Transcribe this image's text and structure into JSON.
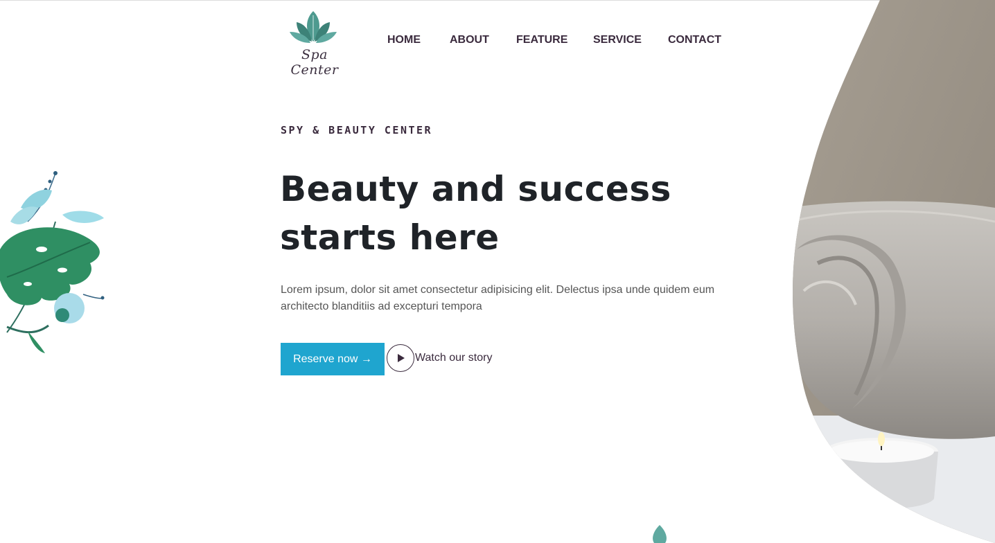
{
  "brand": {
    "logo_text": "Spa Center",
    "accent_color": "#1fa5cf",
    "text_color": "#3a2a3d"
  },
  "nav": {
    "items": [
      {
        "label": "HOME"
      },
      {
        "label": "ABOUT"
      },
      {
        "label": "FEATURE"
      },
      {
        "label": "SERVICE"
      },
      {
        "label": "CONTACT"
      }
    ]
  },
  "hero": {
    "eyebrow": "SPY & BEAUTY CENTER",
    "headline": "Beauty and success starts here",
    "description": "Lorem ipsum, dolor sit amet consectetur adipisicing elit. Delectus ipsa unde quidem eum architecto blanditiis ad excepturi tempora",
    "primary_button": "Reserve now →",
    "secondary_link": "Watch our story",
    "image": "towel-and-candle-photo"
  },
  "icons": {
    "logo": "lotus-icon",
    "play": "play-icon",
    "decor_left": "leaf-decoration-icon",
    "decor_bottom": "leaf-sprout-icon"
  }
}
